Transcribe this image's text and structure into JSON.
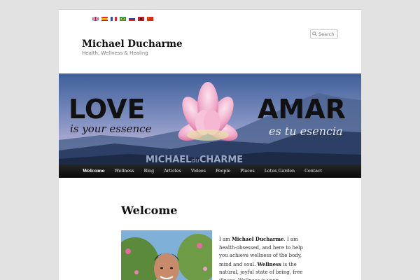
{
  "languages": [
    {
      "name": "english-flag",
      "color": "#1f3c8c"
    },
    {
      "name": "spanish-flag",
      "color": "#c60b1e"
    },
    {
      "name": "french-flag",
      "color": "#2b4fa8"
    },
    {
      "name": "portuguese-brazil-flag",
      "color": "#1d9a3d"
    },
    {
      "name": "russian-flag",
      "color": "#d22"
    },
    {
      "name": "albanian-flag",
      "color": "#d81818"
    },
    {
      "name": "chinese-flag",
      "color": "#de2910"
    }
  ],
  "search": {
    "placeholder": "Search",
    "icon": "search-icon"
  },
  "site": {
    "title": "Michael Ducharme",
    "description": "Health, Wellness & Healing"
  },
  "banner": {
    "left_big": "LOVE",
    "left_sub": "is your essence",
    "right_big": "AMAR",
    "right_sub": "es tu esencia",
    "signature_a": "MICHAEL",
    "signature_b": "du",
    "signature_c": "CHARME"
  },
  "nav": {
    "items": [
      {
        "label": "Welcome",
        "active": true
      },
      {
        "label": "Wellness"
      },
      {
        "label": "Blog"
      },
      {
        "label": "Articles"
      },
      {
        "label": "Videos"
      },
      {
        "label": "People"
      },
      {
        "label": "Places"
      },
      {
        "label": "Lotus Garden"
      },
      {
        "label": "Contact"
      }
    ]
  },
  "entry": {
    "title": "Welcome",
    "p1": "I am ",
    "name": "Michael Ducharme",
    "p2": ". I am health-obsessed, and here to help you achieve wellness of the body, mind and soul. ",
    "wellness": "Wellness",
    "p3": " is the natural, joyful state of being, free illness. Wellness is your"
  },
  "colors": {
    "accent": "#1b8be0",
    "nav_bg": "#111111"
  }
}
